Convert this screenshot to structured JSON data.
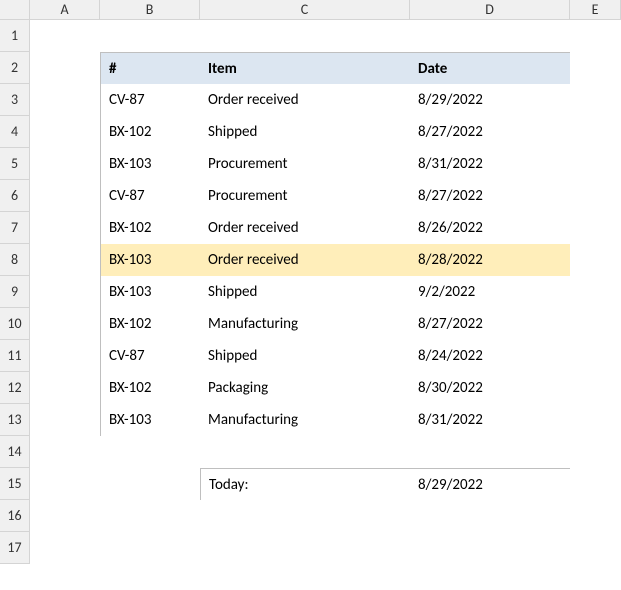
{
  "columns": [
    "A",
    "B",
    "C",
    "D",
    "E"
  ],
  "rows": [
    "1",
    "2",
    "3",
    "4",
    "5",
    "6",
    "7",
    "8",
    "9",
    "10",
    "11",
    "12",
    "13",
    "14",
    "15",
    "16",
    "17"
  ],
  "table": {
    "headers": {
      "id": "#",
      "item": "Item",
      "date": "Date"
    },
    "rows": [
      {
        "id": "CV-87",
        "item": "Order received",
        "date": "8/29/2022",
        "highlight": false
      },
      {
        "id": "BX-102",
        "item": "Shipped",
        "date": "8/27/2022",
        "highlight": false
      },
      {
        "id": "BX-103",
        "item": "Procurement",
        "date": "8/31/2022",
        "highlight": false
      },
      {
        "id": "CV-87",
        "item": "Procurement",
        "date": "8/27/2022",
        "highlight": false
      },
      {
        "id": "BX-102",
        "item": "Order received",
        "date": "8/26/2022",
        "highlight": false
      },
      {
        "id": "BX-103",
        "item": "Order received",
        "date": "8/28/2022",
        "highlight": true
      },
      {
        "id": "BX-103",
        "item": "Shipped",
        "date": "9/2/2022",
        "highlight": false
      },
      {
        "id": "BX-102",
        "item": "Manufacturing",
        "date": "8/27/2022",
        "highlight": false
      },
      {
        "id": "CV-87",
        "item": "Shipped",
        "date": "8/24/2022",
        "highlight": false
      },
      {
        "id": "BX-102",
        "item": "Packaging",
        "date": "8/30/2022",
        "highlight": false
      },
      {
        "id": "BX-103",
        "item": "Manufacturing",
        "date": "8/31/2022",
        "highlight": false
      }
    ]
  },
  "today": {
    "label": "Today:",
    "value": "8/29/2022"
  }
}
